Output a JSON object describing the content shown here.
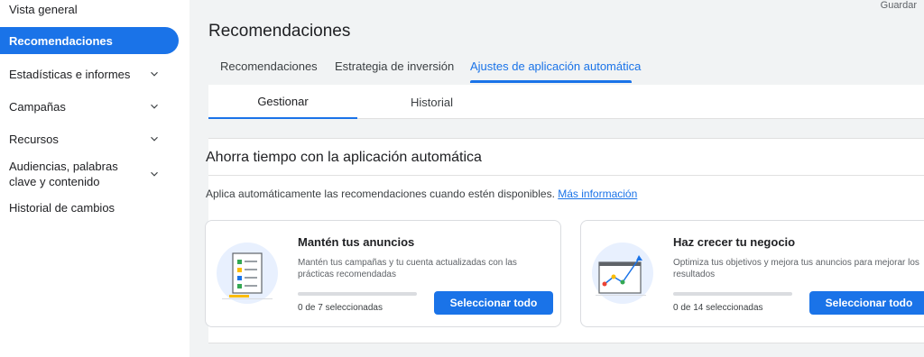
{
  "sidebar": {
    "items": [
      {
        "label": "Vista general"
      },
      {
        "label": "Recomendaciones"
      },
      {
        "label": "Estadísticas e informes"
      },
      {
        "label": "Campañas"
      },
      {
        "label": "Recursos"
      },
      {
        "label": "Audiencias, palabras clave y contenido"
      },
      {
        "label": "Historial de cambios"
      }
    ]
  },
  "header": {
    "save_label": "Guardar",
    "title": "Recomendaciones"
  },
  "tabs": [
    {
      "label": "Recomendaciones"
    },
    {
      "label": "Estrategia de inversión"
    },
    {
      "label": "Ajustes de aplicación automática"
    }
  ],
  "subtabs": [
    {
      "label": "Gestionar"
    },
    {
      "label": "Historial"
    }
  ],
  "panel": {
    "title": "Ahorra tiempo con la aplicación automática",
    "description": "Aplica automáticamente las recomendaciones cuando estén disponibles.",
    "link": "Más información"
  },
  "cards": [
    {
      "title": "Mantén tus anuncios",
      "text": "Mantén tus campañas y tu cuenta actualizadas con las prácticas recomendadas",
      "count": "0 de 7 seleccionadas",
      "progress": 0,
      "button": "Seleccionar todo"
    },
    {
      "title": "Haz crecer tu negocio",
      "text": "Optimiza tus objetivos y mejora tus anuncios para mejorar los resultados",
      "count": "0 de 14 seleccionadas",
      "progress": 0,
      "button": "Seleccionar todo"
    }
  ],
  "colors": {
    "accent": "#1a73e8",
    "background": "#f1f3f4"
  }
}
